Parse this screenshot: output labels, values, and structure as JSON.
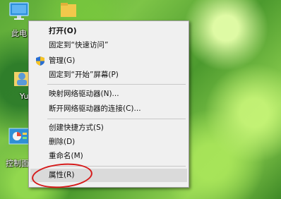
{
  "desktop": {
    "icons": [
      {
        "label": "此电"
      },
      {
        "label": "Yu"
      },
      {
        "label": "控制面"
      }
    ]
  },
  "context_menu": {
    "items": [
      {
        "label": "打开(O)",
        "bold": true
      },
      {
        "label": "固定到“快速访问”"
      },
      {
        "label": "管理(G)",
        "icon": "admin-shield-icon"
      },
      {
        "label": "固定到“开始”屏幕(P)"
      },
      {
        "label": "映射网络驱动器(N)..."
      },
      {
        "label": "断开网络驱动器的连接(C)..."
      },
      {
        "label": "创建快捷方式(S)"
      },
      {
        "label": "删除(D)"
      },
      {
        "label": "重命名(M)"
      },
      {
        "label": "属性(R)",
        "highlighted": true
      }
    ]
  },
  "annotation": {
    "color": "#d61b1b"
  }
}
